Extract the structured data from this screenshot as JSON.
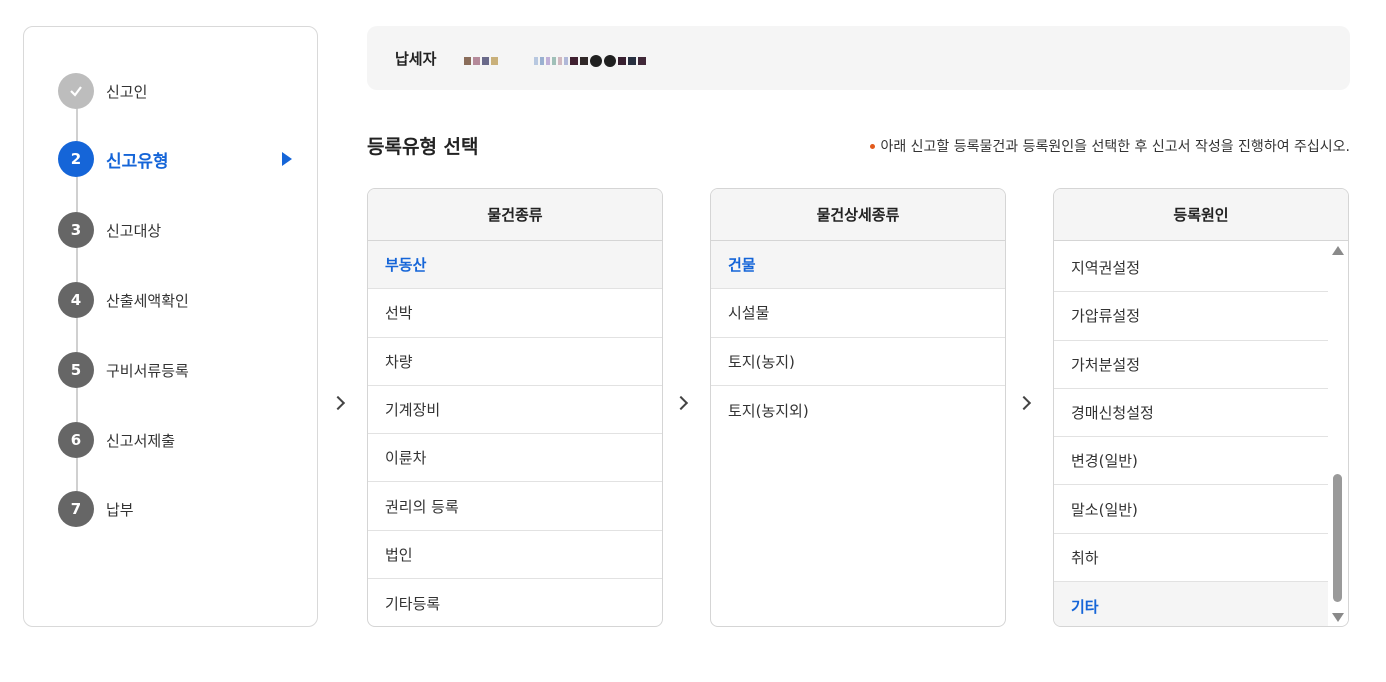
{
  "sidebar": {
    "steps": [
      {
        "num": "✓",
        "label": "신고인"
      },
      {
        "num": "2",
        "label": "신고유형"
      },
      {
        "num": "3",
        "label": "신고대상"
      },
      {
        "num": "4",
        "label": "산출세액확인"
      },
      {
        "num": "5",
        "label": "구비서류등록"
      },
      {
        "num": "6",
        "label": "신고서제출"
      },
      {
        "num": "7",
        "label": "납부"
      }
    ]
  },
  "taxpayer": {
    "label": "납세자"
  },
  "section": {
    "title": "등록유형 선택",
    "notice": "아래 신고할 등록물건과 등록원인을 선택한 후 신고서 작성을 진행하여 주십시오."
  },
  "panels": {
    "property_type": {
      "header": "물건종류",
      "items": [
        "부동산",
        "선박",
        "차량",
        "기계장비",
        "이륜차",
        "권리의 등록",
        "법인",
        "기타등록"
      ]
    },
    "property_detail": {
      "header": "물건상세종류",
      "items": [
        "건물",
        "시설물",
        "토지(농지)",
        "토지(농지외)"
      ]
    },
    "registration_cause": {
      "header": "등록원인",
      "items": [
        "지역권설정",
        "가압류설정",
        "가처분설정",
        "경매신청설정",
        "변경(일반)",
        "말소(일반)",
        "취하",
        "기타"
      ]
    }
  },
  "colors": {
    "accent": "#1565d8",
    "notice_dot": "#e25a1c"
  }
}
